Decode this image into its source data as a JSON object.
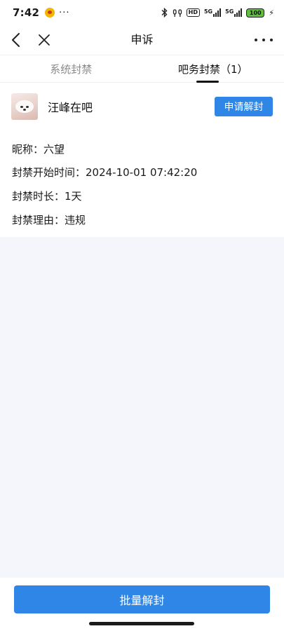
{
  "status_bar": {
    "time": "7:42",
    "dots": "···",
    "hd": "HD",
    "sim1": "5G",
    "sim2": "5G",
    "battery": "100"
  },
  "nav": {
    "title": "申诉"
  },
  "tabs": [
    {
      "label": "系统封禁",
      "active": false
    },
    {
      "label": "吧务封禁（1）",
      "active": true
    }
  ],
  "ban": {
    "forum_name": "汪峰在吧",
    "appeal_button": "申请解封",
    "nickname_line": "昵称：六望",
    "start_time_line": "封禁开始时间：2024-10-01 07:42:20",
    "duration_line": "封禁时长：1天",
    "reason_line": "封禁理由：违规"
  },
  "bottom": {
    "batch_button": "批量解封"
  },
  "colors": {
    "accent": "#2f86e6",
    "page_bg": "#f4f6fb"
  }
}
